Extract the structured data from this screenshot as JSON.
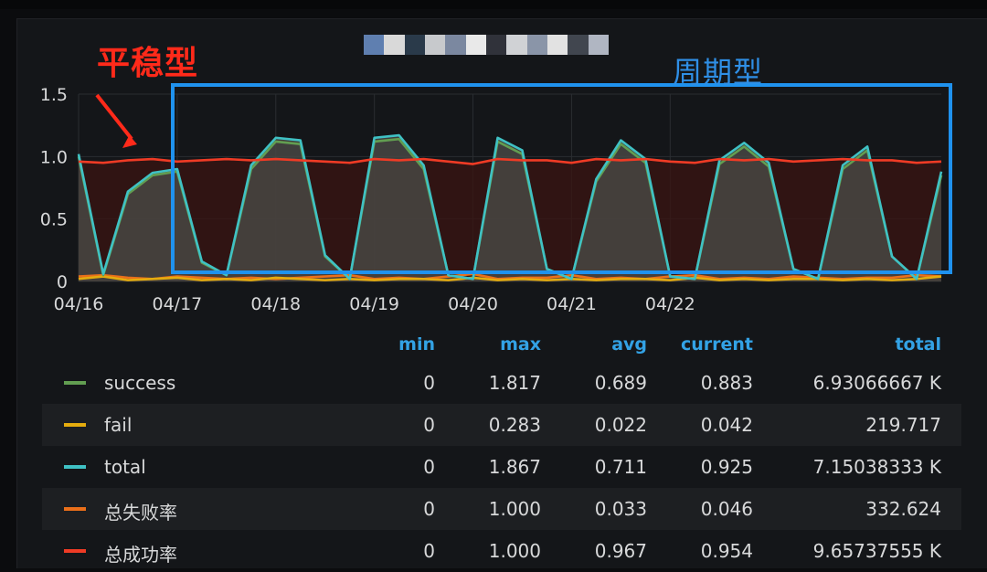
{
  "panel": {
    "title_pixel_colors": [
      "#5f7fb0",
      "#d9d9d9",
      "#2a3a4a",
      "#c7c9cc",
      "#7b88a0",
      "#e9e9e9",
      "#30323a",
      "#d0d2d5",
      "#8a95a8",
      "#e2e2e2",
      "#41464f",
      "#b0b6c2"
    ]
  },
  "annotations": {
    "stable": "平稳型",
    "periodic": "周期型",
    "stable_color": "#ff2a1a",
    "periodic_color": "#2f8fe6"
  },
  "chart_data": {
    "type": "line",
    "x_ticks": [
      "04/16",
      "04/17",
      "04/18",
      "04/19",
      "04/20",
      "04/21",
      "04/22"
    ],
    "y_ticks": [
      "0",
      "0.5",
      "1.0",
      "1.5"
    ],
    "ylim": [
      0,
      1.5
    ],
    "grid": true,
    "x_unit_hours": 1,
    "x": [
      0,
      6,
      12,
      18,
      24,
      30,
      36,
      42,
      48,
      54,
      60,
      66,
      72,
      78,
      84,
      90,
      96,
      102,
      108,
      114,
      120,
      126,
      132,
      138,
      144,
      150,
      156,
      162,
      168,
      174,
      180,
      186,
      192,
      198,
      204,
      210
    ],
    "series": [
      {
        "name": "success",
        "color": "#629e51",
        "values": [
          1.0,
          0.05,
          0.7,
          0.85,
          0.88,
          0.15,
          0.05,
          0.9,
          1.12,
          1.1,
          0.2,
          0.02,
          1.12,
          1.14,
          0.9,
          0.05,
          0.02,
          1.12,
          1.02,
          0.1,
          0.02,
          0.8,
          1.1,
          0.95,
          0.04,
          0.02,
          0.94,
          1.08,
          0.92,
          0.1,
          0.02,
          0.9,
          1.05,
          0.2,
          0.02,
          0.85
        ]
      },
      {
        "name": "fail",
        "color": "#e5ac0e",
        "values": [
          0.02,
          0.04,
          0.01,
          0.02,
          0.03,
          0.01,
          0.02,
          0.01,
          0.03,
          0.02,
          0.01,
          0.02,
          0.01,
          0.02,
          0.02,
          0.01,
          0.03,
          0.01,
          0.02,
          0.01,
          0.02,
          0.01,
          0.02,
          0.02,
          0.01,
          0.03,
          0.01,
          0.02,
          0.01,
          0.02,
          0.02,
          0.01,
          0.02,
          0.01,
          0.02,
          0.04
        ]
      },
      {
        "name": "total",
        "color": "#3fc1c4",
        "values": [
          1.02,
          0.06,
          0.72,
          0.87,
          0.9,
          0.16,
          0.05,
          0.93,
          1.15,
          1.13,
          0.21,
          0.02,
          1.15,
          1.17,
          0.93,
          0.05,
          0.02,
          1.15,
          1.05,
          0.1,
          0.02,
          0.82,
          1.13,
          0.98,
          0.04,
          0.02,
          0.97,
          1.11,
          0.95,
          0.1,
          0.02,
          0.93,
          1.08,
          0.2,
          0.02,
          0.88
        ]
      },
      {
        "name": "总失败率",
        "color": "#ea6f1a",
        "values": [
          0.04,
          0.05,
          0.03,
          0.02,
          0.04,
          0.03,
          0.02,
          0.03,
          0.02,
          0.03,
          0.04,
          0.05,
          0.02,
          0.03,
          0.02,
          0.04,
          0.06,
          0.02,
          0.03,
          0.03,
          0.05,
          0.02,
          0.03,
          0.02,
          0.04,
          0.05,
          0.02,
          0.03,
          0.02,
          0.04,
          0.03,
          0.02,
          0.03,
          0.03,
          0.05,
          0.04
        ]
      },
      {
        "name": "总成功率",
        "color": "#ef3b25",
        "values": [
          0.96,
          0.95,
          0.97,
          0.98,
          0.96,
          0.97,
          0.98,
          0.97,
          0.98,
          0.97,
          0.96,
          0.95,
          0.98,
          0.97,
          0.98,
          0.96,
          0.94,
          0.98,
          0.97,
          0.97,
          0.95,
          0.98,
          0.97,
          0.98,
          0.96,
          0.95,
          0.98,
          0.97,
          0.98,
          0.96,
          0.97,
          0.98,
          0.97,
          0.97,
          0.95,
          0.96
        ]
      }
    ]
  },
  "legend": {
    "headers": {
      "min": "min",
      "max": "max",
      "avg": "avg",
      "current": "current",
      "total": "total"
    },
    "rows": [
      {
        "name": "success",
        "color": "#629e51",
        "min": "0",
        "max": "1.817",
        "avg": "0.689",
        "current": "0.883",
        "total": "6.93066667 K"
      },
      {
        "name": "fail",
        "color": "#e5ac0e",
        "min": "0",
        "max": "0.283",
        "avg": "0.022",
        "current": "0.042",
        "total": "219.717"
      },
      {
        "name": "total",
        "color": "#3fc1c4",
        "min": "0",
        "max": "1.867",
        "avg": "0.711",
        "current": "0.925",
        "total": "7.15038333 K"
      },
      {
        "name": "总失败率",
        "color": "#ea6f1a",
        "min": "0",
        "max": "1.000",
        "avg": "0.033",
        "current": "0.046",
        "total": "332.624"
      },
      {
        "name": "总成功率",
        "color": "#ef3b25",
        "min": "0",
        "max": "1.000",
        "avg": "0.967",
        "current": "0.954",
        "total": "9.65737555 K"
      }
    ]
  }
}
